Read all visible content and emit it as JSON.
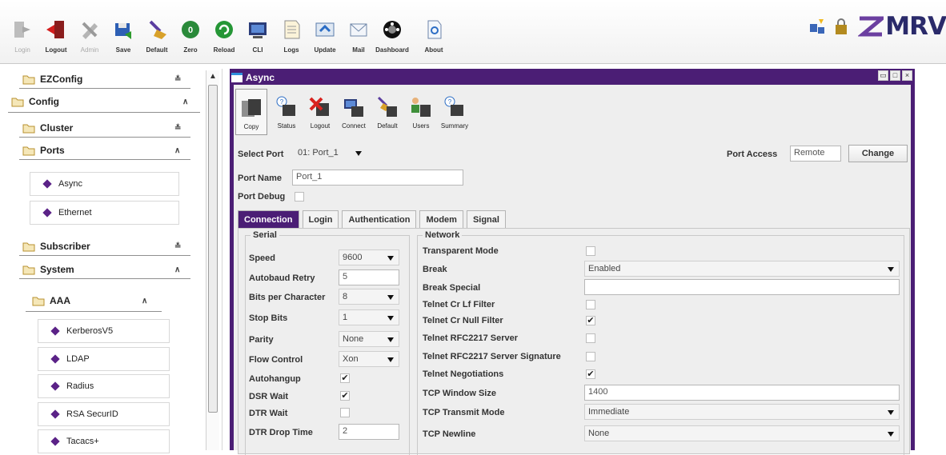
{
  "toolbar": {
    "buttons": [
      {
        "label": "Login",
        "icon": "login-icon",
        "enabled": false
      },
      {
        "label": "Logout",
        "icon": "logout-icon",
        "enabled": true
      },
      {
        "label": "Admin",
        "icon": "admin-icon",
        "enabled": false
      },
      {
        "label": "Save",
        "icon": "save-icon",
        "enabled": true
      },
      {
        "label": "Default",
        "icon": "default-broom-icon",
        "enabled": true
      },
      {
        "label": "Zero",
        "icon": "zero-icon",
        "enabled": true
      },
      {
        "label": "Reload",
        "icon": "reload-icon",
        "enabled": true
      },
      {
        "label": "CLI",
        "icon": "cli-icon",
        "enabled": true
      },
      {
        "label": "Logs",
        "icon": "logs-icon",
        "enabled": true
      },
      {
        "label": "Update",
        "icon": "update-icon",
        "enabled": true
      },
      {
        "label": "Mail",
        "icon": "mail-icon",
        "enabled": true
      },
      {
        "label": "Dashboard",
        "icon": "dashboard-icon",
        "enabled": true
      },
      {
        "label": "About",
        "icon": "about-icon",
        "enabled": true
      }
    ],
    "brand": "MRV",
    "accent": "#4b1e75"
  },
  "nav": {
    "sections": [
      {
        "label": "EZConfig",
        "expanded": false
      },
      {
        "label": "Config",
        "expanded": true
      },
      {
        "label": "Cluster",
        "expanded": false
      },
      {
        "label": "Ports",
        "expanded": true
      },
      {
        "label": "Subscriber",
        "expanded": false
      },
      {
        "label": "System",
        "expanded": true
      },
      {
        "label": "AAA",
        "expanded": true
      }
    ],
    "ports_items": [
      "Async",
      "Ethernet"
    ],
    "aaa_items": [
      "KerberosV5",
      "LDAP",
      "Radius",
      "RSA SecurID",
      "Tacacs+"
    ]
  },
  "window": {
    "title": "Async",
    "actions": [
      {
        "label": "Copy",
        "icon": "copy-icon"
      },
      {
        "label": "Status",
        "icon": "status-icon"
      },
      {
        "label": "Logout",
        "icon": "logout-port-icon"
      },
      {
        "label": "Connect",
        "icon": "connect-icon"
      },
      {
        "label": "Default",
        "icon": "default-icon"
      },
      {
        "label": "Users",
        "icon": "users-icon"
      },
      {
        "label": "Summary",
        "icon": "summary-icon"
      }
    ],
    "select_port_label": "Select Port",
    "select_port_value": "01: Port_1",
    "port_access_label": "Port Access",
    "port_access_value": "Remote",
    "change_label": "Change",
    "port_name_label": "Port Name",
    "port_name_value": "Port_1",
    "port_debug_label": "Port Debug",
    "tabs": [
      "Connection",
      "Login",
      "Authentication",
      "Modem",
      "Signal"
    ],
    "active_tab": "Connection",
    "serial": {
      "title": "Serial",
      "speed_label": "Speed",
      "speed_value": "9600",
      "autobaud_label": "Autobaud Retry",
      "autobaud_value": "5",
      "bits_label": "Bits per Character",
      "bits_value": "8",
      "stop_label": "Stop Bits",
      "stop_value": "1",
      "parity_label": "Parity",
      "parity_value": "None",
      "flow_label": "Flow Control",
      "flow_value": "Xon",
      "autohangup_label": "Autohangup",
      "autohangup_checked": true,
      "dsr_label": "DSR Wait",
      "dsr_checked": true,
      "dtr_label": "DTR Wait",
      "dtr_checked": false,
      "dtr_drop_label": "DTR Drop Time",
      "dtr_drop_value": "2"
    },
    "network": {
      "title": "Network",
      "transparent_label": "Transparent Mode",
      "transparent_checked": false,
      "break_label": "Break",
      "break_value": "Enabled",
      "break_special_label": "Break Special",
      "break_special_value": "",
      "crlf_label": "Telnet Cr Lf Filter",
      "crlf_checked": false,
      "crnull_label": "Telnet Cr Null Filter",
      "crnull_checked": true,
      "rfc_label": "Telnet RFC2217 Server",
      "rfc_checked": false,
      "rfcsig_label": "Telnet RFC2217 Server Signature",
      "rfcsig_checked": false,
      "negot_label": "Telnet Negotiations",
      "negot_checked": true,
      "tcpwin_label": "TCP Window Size",
      "tcpwin_value": "1400",
      "tcptx_label": "TCP Transmit Mode",
      "tcptx_value": "Immediate",
      "tcpnl_label": "TCP Newline",
      "tcpnl_value": "None"
    }
  }
}
